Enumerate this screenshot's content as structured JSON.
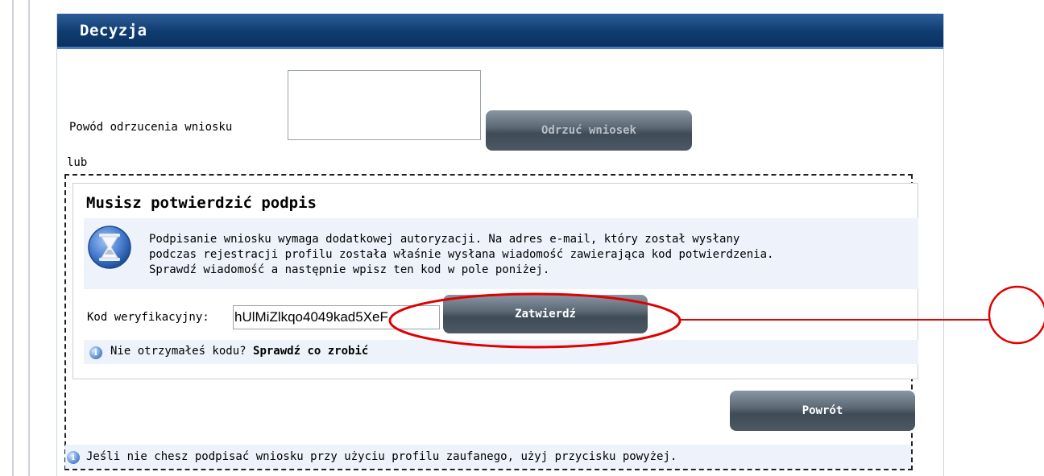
{
  "panel": {
    "title": "Decyzja"
  },
  "reject": {
    "reason_label": "Powód odrzucenia wniosku",
    "button_label": "Odrzuć wniosek",
    "or_label": "lub"
  },
  "confirm": {
    "title": "Musisz potwierdzić podpis",
    "message_lines": [
      "Podpisanie wniosku wymaga dodatkowej autoryzacji. Na adres e-mail, który został wysłany",
      "podczas rejestracji profilu została właśnie wysłana wiadomość zawierająca kod potwierdzenia.",
      "Sprawdź wiadomość a następnie wpisz ten kod w pole poniżej."
    ],
    "code_label": "Kod weryfikacyjny:",
    "code_value": "hUlMiZlkqo4049kad5XeF",
    "submit_label": "Zatwierdź",
    "no_code_text": "Nie otrzymałeś kodu?",
    "no_code_link": "Sprawdź co zrobić"
  },
  "back": {
    "button_label": "Powrót"
  },
  "footer_info": "Jeśli nie chesz podpisać wniosku przy użyciu profilu zaufanego, użyj przycisku powyżej.",
  "icons": {
    "hourglass": "hourglass-icon",
    "info": "info-icon"
  },
  "colors": {
    "header_bg": "#0f3c70",
    "button_bg": "#4c5864",
    "info_bg": "#eef3fb",
    "annotation": "#e00000"
  }
}
